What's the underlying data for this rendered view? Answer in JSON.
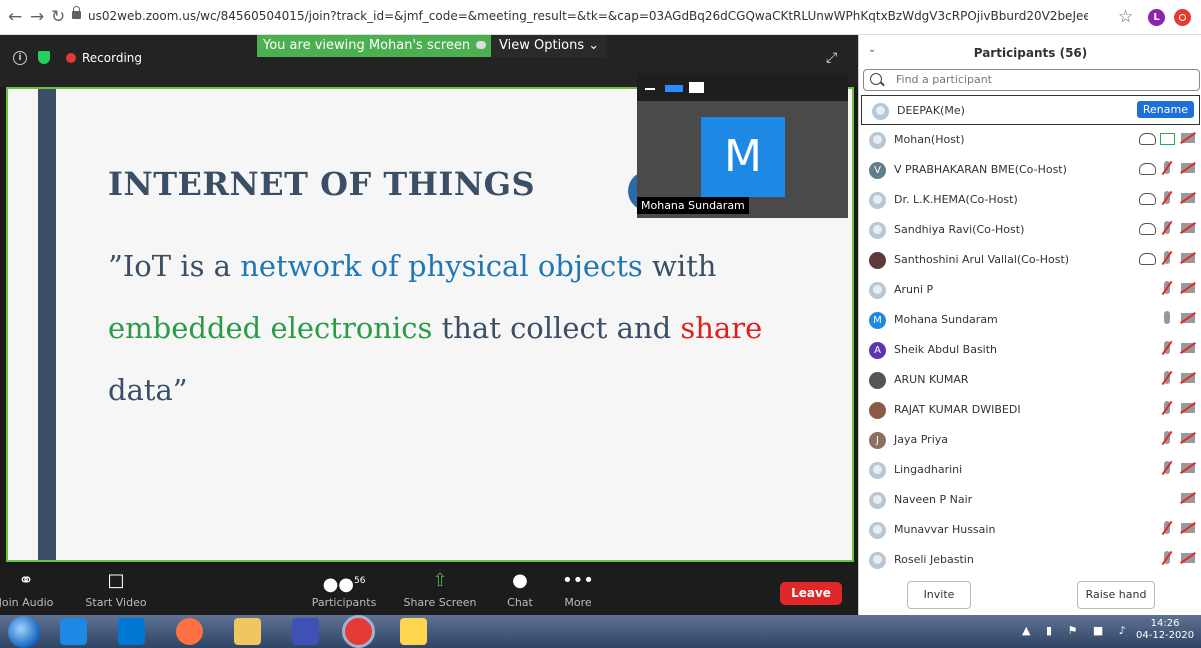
{
  "browser": {
    "url": "us02web.zoom.us/wc/84560504015/join?track_id=&jmf_code=&meeting_result=&tk=&cap=03AGdBq26dCGQwaCKtRLUnwWPhKqtxBzWdgV3cRPOjivBburd20V2beJeeSc_30p1J...",
    "profile_initial": "L"
  },
  "meeting": {
    "recording_label": "Recording",
    "viewing_label": "You are viewing Mohan's screen",
    "view_options_label": "View Options"
  },
  "slide": {
    "title": "INTERNET OF THINGS",
    "q_open": "”IoT is a ",
    "q_blue": "network of physical objects",
    "q_mid1": " with",
    "q_green": "embedded electronics",
    "q_mid2": " that collect and ",
    "q_red": "share",
    "q_end": "data”"
  },
  "thumbnail": {
    "avatar_letter": "M",
    "name": "Mohana Sundaram"
  },
  "toolbar": {
    "join_audio": "Join Audio",
    "start_video": "Start Video",
    "participants": "Participants",
    "participant_count": "56",
    "share_screen": "Share Screen",
    "chat": "Chat",
    "more": "More",
    "leave": "Leave"
  },
  "panel": {
    "title": "Participants (56)",
    "search_placeholder": "Find a participant",
    "rename_label": "Rename",
    "invite_label": "Invite",
    "raise_hand_label": "Raise hand",
    "participants": [
      {
        "name": "DEEPAK(Me)"
      },
      {
        "name": "Mohan(Host)"
      },
      {
        "name": "V PRABHAKARAN BME(Co-Host)",
        "initial": "V"
      },
      {
        "name": "Dr. L.K.HEMA(Co-Host)"
      },
      {
        "name": "Sandhiya Ravi(Co-Host)"
      },
      {
        "name": "Santhoshini Arul Vallal(Co-Host)"
      },
      {
        "name": "Aruni P"
      },
      {
        "name": "Mohana Sundaram",
        "initial": "M"
      },
      {
        "name": "Sheik Abdul Basith",
        "initial": "A"
      },
      {
        "name": "ARUN KUMAR"
      },
      {
        "name": "RAJAT KUMAR DWIBEDI"
      },
      {
        "name": "Jaya Priya",
        "initial": "J"
      },
      {
        "name": "Lingadharini"
      },
      {
        "name": "Naveen P Nair"
      },
      {
        "name": "Munavvar Hussain"
      },
      {
        "name": "Roseli Jebastin"
      }
    ]
  },
  "taskbar": {
    "time": "14:26",
    "date": "04-12-2020"
  },
  "colors": {
    "accent": "#2d8cff",
    "leave": "#e02828",
    "share_green": "#4caf50"
  }
}
